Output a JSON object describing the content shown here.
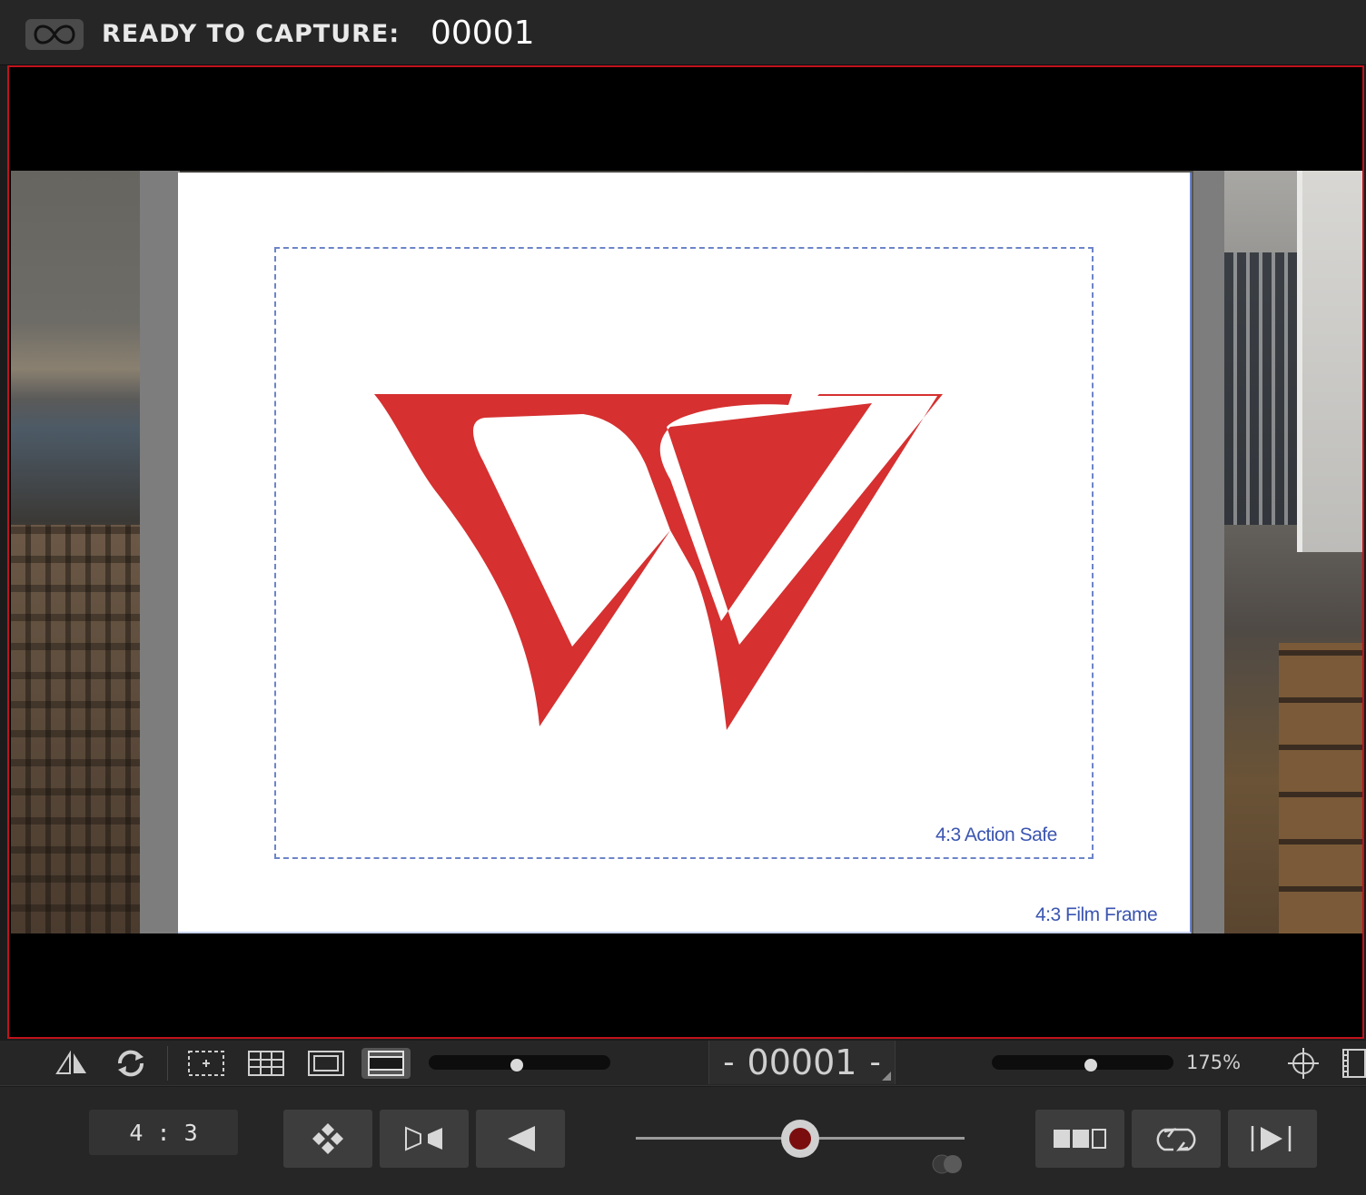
{
  "header": {
    "status_label": "READY TO CAPTURE:",
    "frame_number": "00001",
    "onion_skin_icon": "infinity-icon"
  },
  "viewer": {
    "card": {
      "logo_icon": "red-w-logo-icon",
      "action_safe_label": "4:3 Action Safe",
      "film_frame_label": "4:3 Film Frame",
      "logo_color": "#d63030",
      "guide_color": "#6d84c8"
    },
    "border_color": "#c1121b"
  },
  "toolbar": {
    "icons": [
      "flip-icon",
      "rotate-icon",
      "center-guide-icon",
      "grid-icon",
      "title-safe-icon",
      "widescreen-icon",
      "crosshair-icon",
      "filmstrip-icon"
    ],
    "opacity_slider_level": 0.5,
    "frame_nav": {
      "prev": "-",
      "value": "00001",
      "next": "-"
    },
    "zoom_slider_level": 0.55,
    "zoom_label": "175%"
  },
  "controls": {
    "aspect_ratio": "4 : 3",
    "buttons": [
      "diamond-icon",
      "bowtie-icon",
      "play-back-icon",
      "layout-icon",
      "loop-icon",
      "skip-end-icon"
    ],
    "capture_slider_level": 0.5
  }
}
